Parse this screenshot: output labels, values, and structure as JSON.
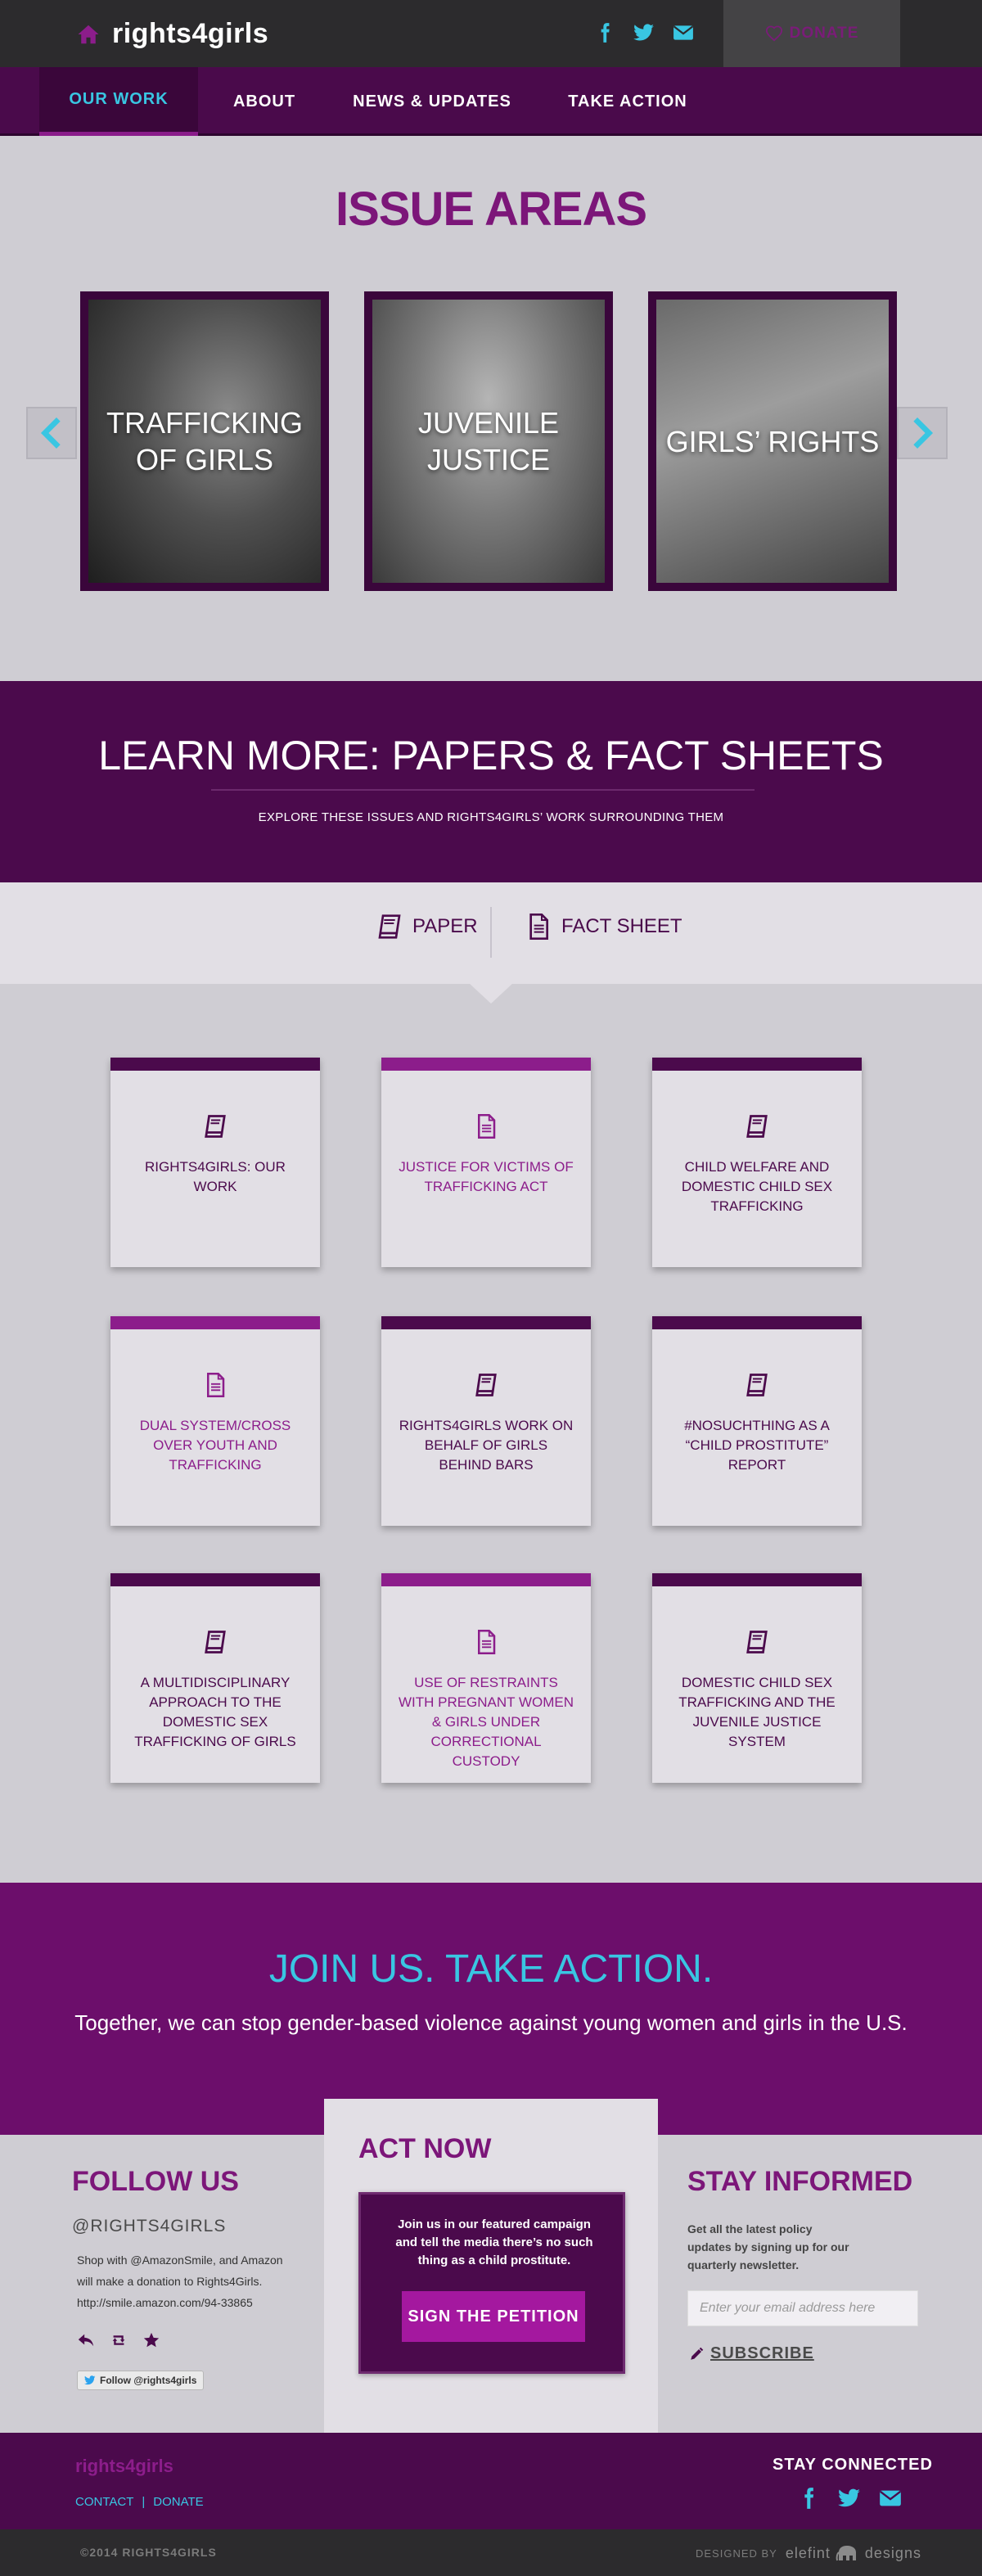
{
  "header": {
    "brand": "rights4girls",
    "donate_label": "DONATE"
  },
  "nav": {
    "items": [
      {
        "label": "OUR WORK",
        "active": true
      },
      {
        "label": "ABOUT",
        "active": false
      },
      {
        "label": "NEWS & UPDATES",
        "active": false
      },
      {
        "label": "TAKE ACTION",
        "active": false
      }
    ]
  },
  "issues": {
    "title": "ISSUE AREAS",
    "cards": [
      {
        "line1": "TRAFFICKING",
        "line2": "OF GIRLS"
      },
      {
        "line1": "JUVENILE",
        "line2": "JUSTICE"
      },
      {
        "line1": "GIRLS’ RIGHTS",
        "line2": ""
      }
    ]
  },
  "learn_more": {
    "title": "LEARN MORE: PAPERS & FACT SHEETS",
    "subtitle": "EXPLORE THESE ISSUES AND RIGHTS4GIRLS’ WORK SURROUNDING THEM"
  },
  "filters": {
    "paper_label": "PAPER",
    "fact_label": "FACT SHEET"
  },
  "documents": [
    {
      "type": "paper",
      "title": "RIGHTS4GIRLS: OUR WORK",
      "icon": "book-icon"
    },
    {
      "type": "fact",
      "title": "JUSTICE FOR VICTIMS OF TRAFFICKING ACT",
      "icon": "document-icon"
    },
    {
      "type": "paper",
      "title": "CHILD WELFARE AND DOMESTIC CHILD SEX TRAFFICKING",
      "icon": "book-icon"
    },
    {
      "type": "fact",
      "title": "DUAL SYSTEM/CROSS OVER YOUTH AND TRAFFICKING",
      "icon": "document-icon"
    },
    {
      "type": "paper",
      "title": "RIGHTS4GIRLS WORK ON BEHALF OF GIRLS BEHIND BARS",
      "icon": "book-icon"
    },
    {
      "type": "paper",
      "title": "#NOSUCHTHING AS A “CHILD PROSTITUTE” REPORT",
      "icon": "book-icon"
    },
    {
      "type": "paper",
      "title": "A MULTIDISCIPLINARY APPROACH TO THE DOMESTIC SEX TRAFFICKING OF GIRLS",
      "icon": "book-icon"
    },
    {
      "type": "fact",
      "title": "USE OF RESTRAINTS WITH PREGNANT WOMEN & GIRLS UNDER CORRECTIONAL CUSTODY",
      "icon": "document-icon"
    },
    {
      "type": "paper",
      "title": "DOMESTIC CHILD SEX TRAFFICKING AND THE JUVENILE JUSTICE SYSTEM",
      "icon": "book-icon"
    }
  ],
  "join": {
    "title": "JOIN US. TAKE ACTION.",
    "subtitle": "Together, we can stop gender-based violence against young women and girls in the U.S."
  },
  "follow": {
    "heading": "FOLLOW US",
    "handle": "@RIGHTS4GIRLS",
    "text": "Shop with @AmazonSmile, and Amazon will make a donation to Rights4Girls. http://smile.amazon.com/94-33865",
    "follow_button": "Follow @rights4girls"
  },
  "act_now": {
    "heading": "ACT NOW",
    "text": "Join us in our featured campaign and tell the media there’s no such thing as a child prostitute.",
    "button": "SIGN THE PETITION"
  },
  "stay_informed": {
    "heading": "STAY INFORMED",
    "text": "Get all the latest policy updates by signing up for our quarterly newsletter.",
    "email_placeholder": "Enter your email address here",
    "subscribe": "SUBSCRIBE"
  },
  "footer": {
    "brand": "rights4girls",
    "contact": "CONTACT",
    "sep": "|",
    "donate": "DONATE",
    "stay_connected": "STAY CONNECTED",
    "copyright": "©2014 RIGHTS4GIRLS",
    "designed_by": "DESIGNED BY",
    "designer": "elefint",
    "designer_suffix": "designs"
  },
  "colors": {
    "purple_dark": "#4b0a4c",
    "purple": "#7c1679",
    "magenta": "#8c1d8b",
    "cyan": "#39c6e2",
    "bg": "#cfcdd3"
  }
}
